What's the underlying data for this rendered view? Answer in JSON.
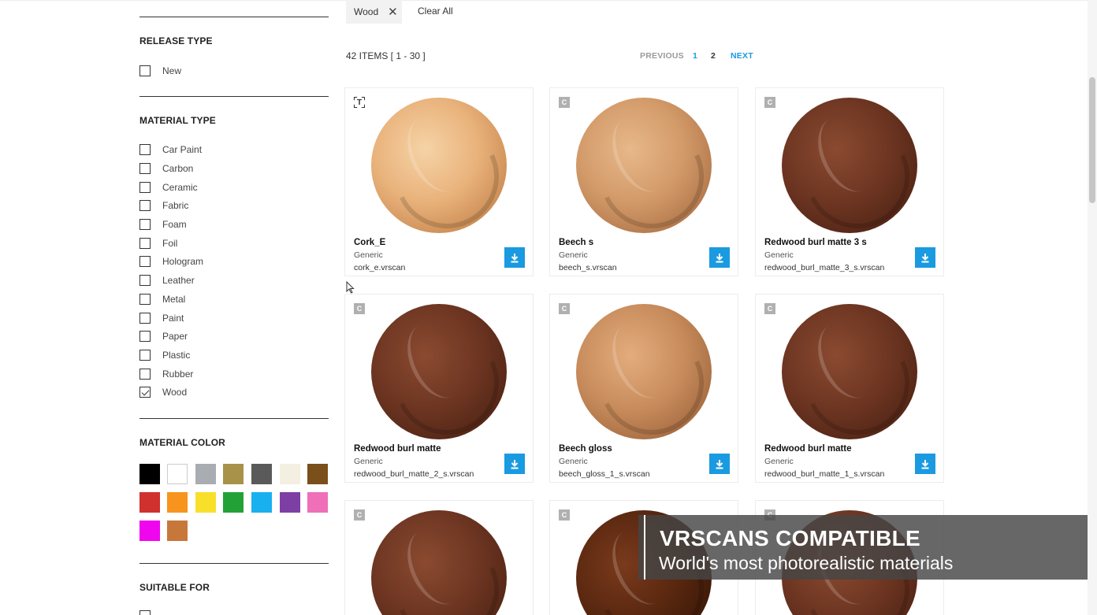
{
  "sidebar": {
    "release_type": {
      "title": "RELEASE TYPE",
      "options": [
        "New"
      ]
    },
    "material_type": {
      "title": "MATERIAL TYPE",
      "options": [
        "Car Paint",
        "Carbon",
        "Ceramic",
        "Fabric",
        "Foam",
        "Foil",
        "Hologram",
        "Leather",
        "Metal",
        "Paint",
        "Paper",
        "Plastic",
        "Rubber",
        "Wood"
      ],
      "checked": "Wood"
    },
    "material_color": {
      "title": "MATERIAL COLOR",
      "swatches": [
        "#000000",
        "#ffffff",
        "#a9adb1",
        "#a8924a",
        "#5a5a5a",
        "#f3efe1",
        "#7a4f1a",
        "#d0302e",
        "#f7941d",
        "#f8e02a",
        "#22a236",
        "#1ab0f0",
        "#7e3fa4",
        "#ef6fb8",
        "#f006ee",
        "#c8773a"
      ]
    },
    "suitable_for": {
      "title": "SUITABLE FOR"
    }
  },
  "filters": {
    "active_chip": "Wood",
    "clear_all": "Clear All"
  },
  "results": {
    "count_label": "42 ITEMS [ 1 - 30 ]",
    "pagination": {
      "previous": "PREVIOUS",
      "page1": "1",
      "page2": "2",
      "next": "NEXT"
    }
  },
  "cards": [
    {
      "badge": "T",
      "name": "Cork_E",
      "type": "Generic",
      "file": "cork_e.vrscan"
    },
    {
      "badge": "C",
      "name": "Beech s",
      "type": "Generic",
      "file": "beech_s.vrscan"
    },
    {
      "badge": "C",
      "name": "Redwood burl matte 3 s",
      "type": "Generic",
      "file": "redwood_burl_matte_3_s.vrscan"
    },
    {
      "badge": "C",
      "name": "Redwood burl matte",
      "type": "Generic",
      "file": "redwood_burl_matte_2_s.vrscan"
    },
    {
      "badge": "C",
      "name": "Beech gloss",
      "type": "Generic",
      "file": "beech_gloss_1_s.vrscan"
    },
    {
      "badge": "C",
      "name": "Redwood burl matte",
      "type": "Generic",
      "file": "redwood_burl_matte_1_s.vrscan"
    },
    {
      "badge": "C"
    },
    {
      "badge": "C"
    },
    {
      "badge": "C"
    }
  ],
  "banner": {
    "title": "VRSCANS COMPATIBLE",
    "subtitle": "World's most photorealistic materials"
  },
  "colors": {
    "accent": "#1a9ae0",
    "pager_inactive": "#9a9a9a",
    "pager_current": "#333333"
  }
}
